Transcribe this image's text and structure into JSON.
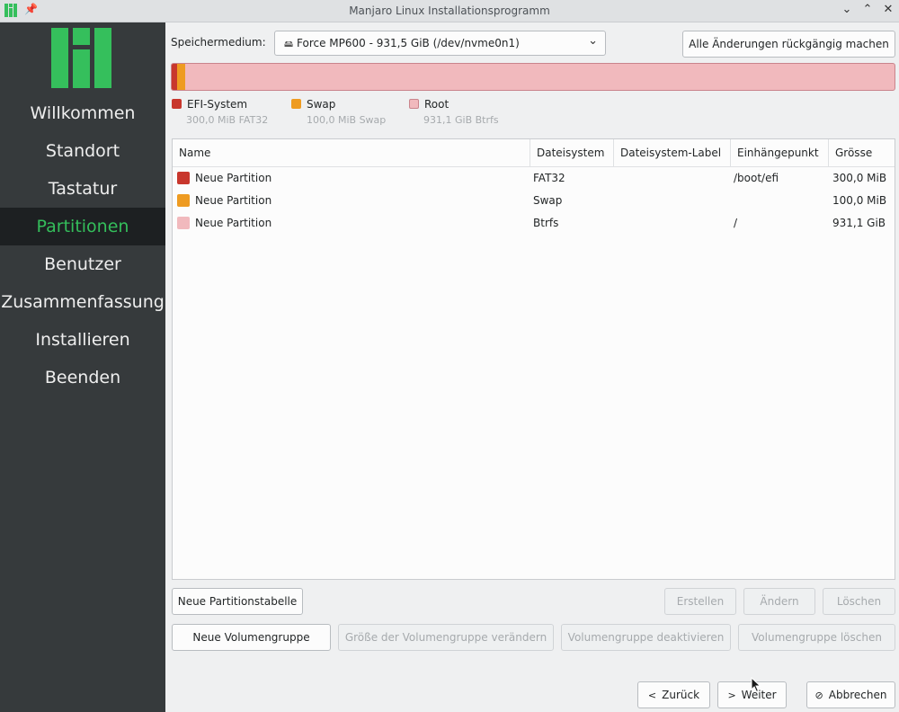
{
  "window": {
    "title": "Manjaro Linux Installationsprogramm"
  },
  "colors": {
    "sidebar_bg": "#363a3c",
    "active_bg": "#1d2022",
    "active_text": "#34be5b",
    "logo": "#35bf5c",
    "efi": "#c8372d",
    "swap": "#ee9b21",
    "root": "#f1b9bd"
  },
  "sidebar": {
    "items": [
      {
        "label": "Willkommen",
        "active": false
      },
      {
        "label": "Standort",
        "active": false
      },
      {
        "label": "Tastatur",
        "active": false
      },
      {
        "label": "Partitionen",
        "active": true
      },
      {
        "label": "Benutzer",
        "active": false
      },
      {
        "label": "Zusammenfassung",
        "active": false
      },
      {
        "label": "Installieren",
        "active": false
      },
      {
        "label": "Beenden",
        "active": false
      }
    ]
  },
  "storage": {
    "label": "Speichermedium:",
    "value": "Force MP600 - 931,5 GiB (/dev/nvme0n1)"
  },
  "revert_button": "Alle Änderungen rückgängig machen",
  "legend": [
    {
      "name": "EFI-System",
      "detail": "300,0 MiB FAT32"
    },
    {
      "name": "Swap",
      "detail": "100,0 MiB Swap"
    },
    {
      "name": "Root",
      "detail": "931,1 GiB Btrfs"
    }
  ],
  "table": {
    "columns": [
      "Name",
      "Dateisystem",
      "Dateisystem-Label",
      "Einhängepunkt",
      "Grösse"
    ],
    "rows": [
      {
        "name": "Neue Partition",
        "fs": "FAT32",
        "label": "",
        "mount": "/boot/efi",
        "size": "300,0 MiB"
      },
      {
        "name": "Neue Partition",
        "fs": "Swap",
        "label": "",
        "mount": "",
        "size": "100,0 MiB"
      },
      {
        "name": "Neue Partition",
        "fs": "Btrfs",
        "label": "",
        "mount": "/",
        "size": "931,1 GiB"
      }
    ]
  },
  "buttons": {
    "new_table": "Neue Partitionstabelle",
    "create": "Erstellen",
    "edit": "Ändern",
    "delete": "Löschen",
    "new_vg": "Neue Volumengruppe",
    "resize_vg": "Größe der Volumengruppe verändern",
    "deactivate_vg": "Volumengruppe deaktivieren",
    "delete_vg": "Volumengruppe löschen"
  },
  "footer": {
    "back": "Zurück",
    "next": "Weiter",
    "cancel": "Abbrechen"
  }
}
